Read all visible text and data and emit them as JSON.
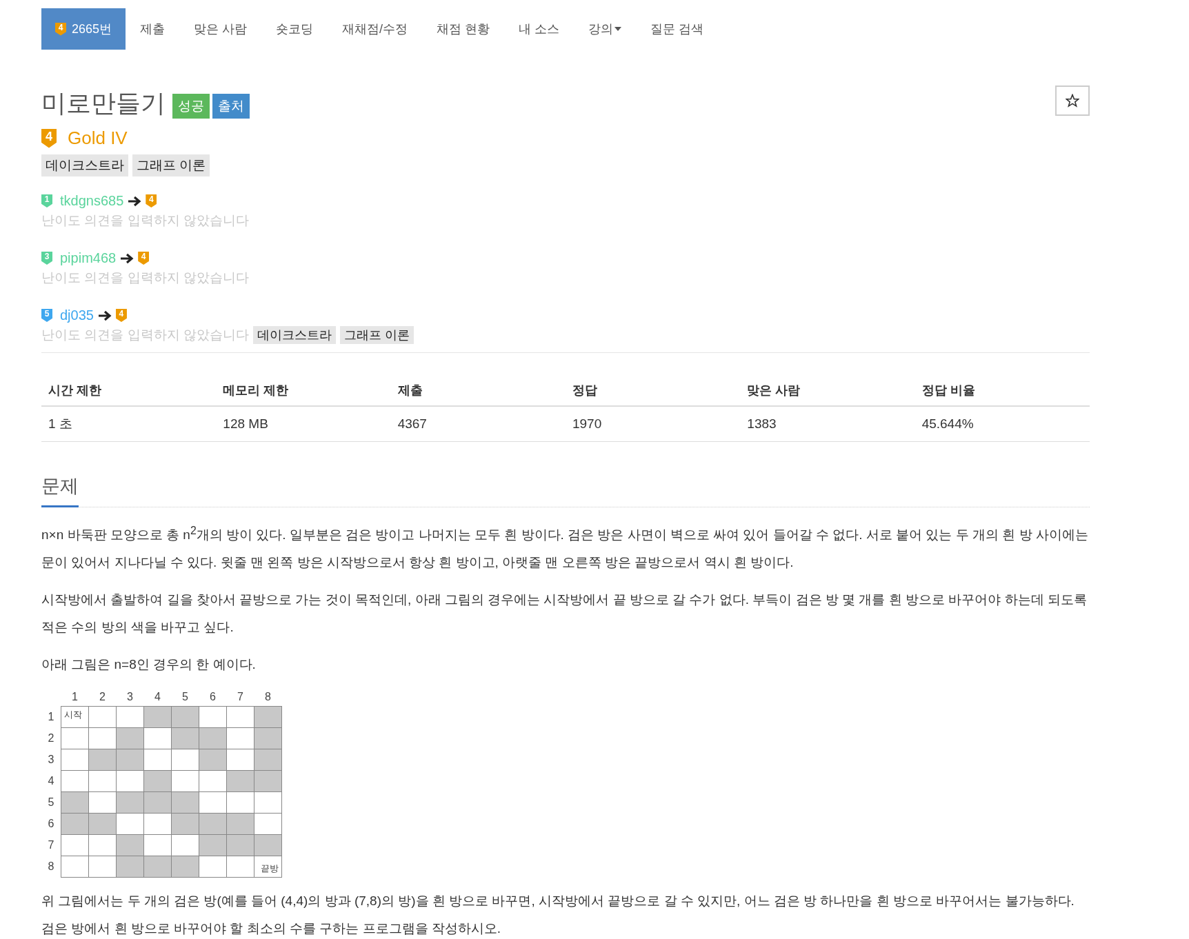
{
  "nav": {
    "tabs": [
      {
        "label": "2665번",
        "tier": "4",
        "selected": true
      },
      {
        "label": "제출",
        "selected": false
      },
      {
        "label": "맞은 사람",
        "selected": false
      },
      {
        "label": "숏코딩",
        "selected": false
      },
      {
        "label": "재채점/수정",
        "selected": false
      },
      {
        "label": "채점 현황",
        "selected": false
      },
      {
        "label": "내 소스",
        "selected": false
      },
      {
        "label": "강의",
        "dropdown": true,
        "selected": false
      },
      {
        "label": "질문 검색",
        "selected": false
      }
    ]
  },
  "problem": {
    "title": "미로만들기",
    "labels": [
      {
        "text": "성공",
        "color": "#5cb85c"
      },
      {
        "text": "출처",
        "color": "#428bca"
      }
    ],
    "starred": false,
    "tier": {
      "badge": "4",
      "name": "Gold IV",
      "color": "#ec9a00"
    },
    "tags": [
      "데이크스트라",
      "그래프 이론"
    ]
  },
  "opinions": [
    {
      "user": "tkdgns685",
      "badge": "1",
      "color": "#5ad49c",
      "to": "4",
      "comment": "난이도 의견을 입력하지 않았습니다"
    },
    {
      "user": "pipim468",
      "badge": "3",
      "color": "#5ad49c",
      "to": "4",
      "comment": "난이도 의견을 입력하지 않았습니다"
    },
    {
      "user": "dj035",
      "badge": "5",
      "color": "#3ea7ef",
      "to": "4",
      "comment": "난이도 의견을 입력하지 않았습니다",
      "tags": [
        "데이크스트라",
        "그래프 이론"
      ]
    }
  ],
  "stats": {
    "columns": [
      "시간 제한",
      "메모리 제한",
      "제출",
      "정답",
      "맞은 사람",
      "정답 비율"
    ],
    "row": [
      "1 초",
      "128 MB",
      "4367",
      "1970",
      "1383",
      "45.644%"
    ]
  },
  "section": {
    "title": "문제",
    "paragraphs_before": [
      "n×n 바둑판 모양으로 총 n$^{2}$개의 방이 있다. 일부분은 검은 방이고 나머지는 모두 흰 방이다. 검은 방은 사면이 벽으로 싸여 있어 들어갈 수 없다. 서로 붙어 있는 두 개의 흰 방 사이에는 문이 있어서 지나다닐 수 있다. 윗줄 맨 왼쪽 방은 시작방으로서 항상 흰 방이고, 아랫줄 맨 오른쪽 방은 끝방으로서 역시 흰 방이다.",
      "시작방에서 출발하여 길을 찾아서 끝방으로 가는 것이 목적인데, 아래 그림의 경우에는 시작방에서 끝 방으로 갈 수가 없다. 부득이 검은 방 몇 개를 흰 방으로 바꾸어야 하는데 되도록 적은 수의 방의 색을 바꾸고 싶다.",
      "아래 그림은 n=8인 경우의 한 예이다."
    ],
    "figure": {
      "column_labels": [
        "1",
        "2",
        "3",
        "4",
        "5",
        "6",
        "7",
        "8"
      ],
      "rows": [
        {
          "label": "1",
          "cells": [
            {
              "dark": false,
              "text": "시작"
            },
            {
              "dark": false
            },
            {
              "dark": false
            },
            {
              "dark": true
            },
            {
              "dark": true
            },
            {
              "dark": false
            },
            {
              "dark": false
            },
            {
              "dark": true
            }
          ]
        },
        {
          "label": "2",
          "cells": [
            {
              "dark": false
            },
            {
              "dark": false
            },
            {
              "dark": true
            },
            {
              "dark": false
            },
            {
              "dark": true
            },
            {
              "dark": true
            },
            {
              "dark": false
            },
            {
              "dark": true
            }
          ]
        },
        {
          "label": "3",
          "cells": [
            {
              "dark": false
            },
            {
              "dark": true
            },
            {
              "dark": true
            },
            {
              "dark": false
            },
            {
              "dark": false
            },
            {
              "dark": true
            },
            {
              "dark": false
            },
            {
              "dark": true
            }
          ]
        },
        {
          "label": "4",
          "cells": [
            {
              "dark": false
            },
            {
              "dark": false
            },
            {
              "dark": false
            },
            {
              "dark": true
            },
            {
              "dark": false
            },
            {
              "dark": false
            },
            {
              "dark": true
            },
            {
              "dark": true
            }
          ]
        },
        {
          "label": "5",
          "cells": [
            {
              "dark": true
            },
            {
              "dark": false
            },
            {
              "dark": true
            },
            {
              "dark": true
            },
            {
              "dark": true
            },
            {
              "dark": false
            },
            {
              "dark": false
            },
            {
              "dark": false
            }
          ]
        },
        {
          "label": "6",
          "cells": [
            {
              "dark": true
            },
            {
              "dark": true
            },
            {
              "dark": false
            },
            {
              "dark": false
            },
            {
              "dark": true
            },
            {
              "dark": true
            },
            {
              "dark": true
            },
            {
              "dark": false
            }
          ]
        },
        {
          "label": "7",
          "cells": [
            {
              "dark": false
            },
            {
              "dark": false
            },
            {
              "dark": true
            },
            {
              "dark": false
            },
            {
              "dark": false
            },
            {
              "dark": true
            },
            {
              "dark": true
            },
            {
              "dark": true
            }
          ]
        },
        {
          "label": "8",
          "cells": [
            {
              "dark": false
            },
            {
              "dark": false
            },
            {
              "dark": true
            },
            {
              "dark": true
            },
            {
              "dark": true
            },
            {
              "dark": false
            },
            {
              "dark": false
            },
            {
              "dark": false,
              "text": "끝방"
            }
          ]
        }
      ]
    },
    "paragraphs_after": [
      "위 그림에서는 두 개의 검은 방(예를 들어 (4,4)의 방과 (7,8)의 방)을 흰 방으로 바꾸면, 시작방에서 끝방으로 갈 수 있지만, 어느 검은 방 하나만을 흰 방으로 바꾸어서는 불가능하다. 검은 방에서 흰 방으로 바꾸어야 할 최소의 수를 구하는 프로그램을 작성하시오."
    ]
  }
}
